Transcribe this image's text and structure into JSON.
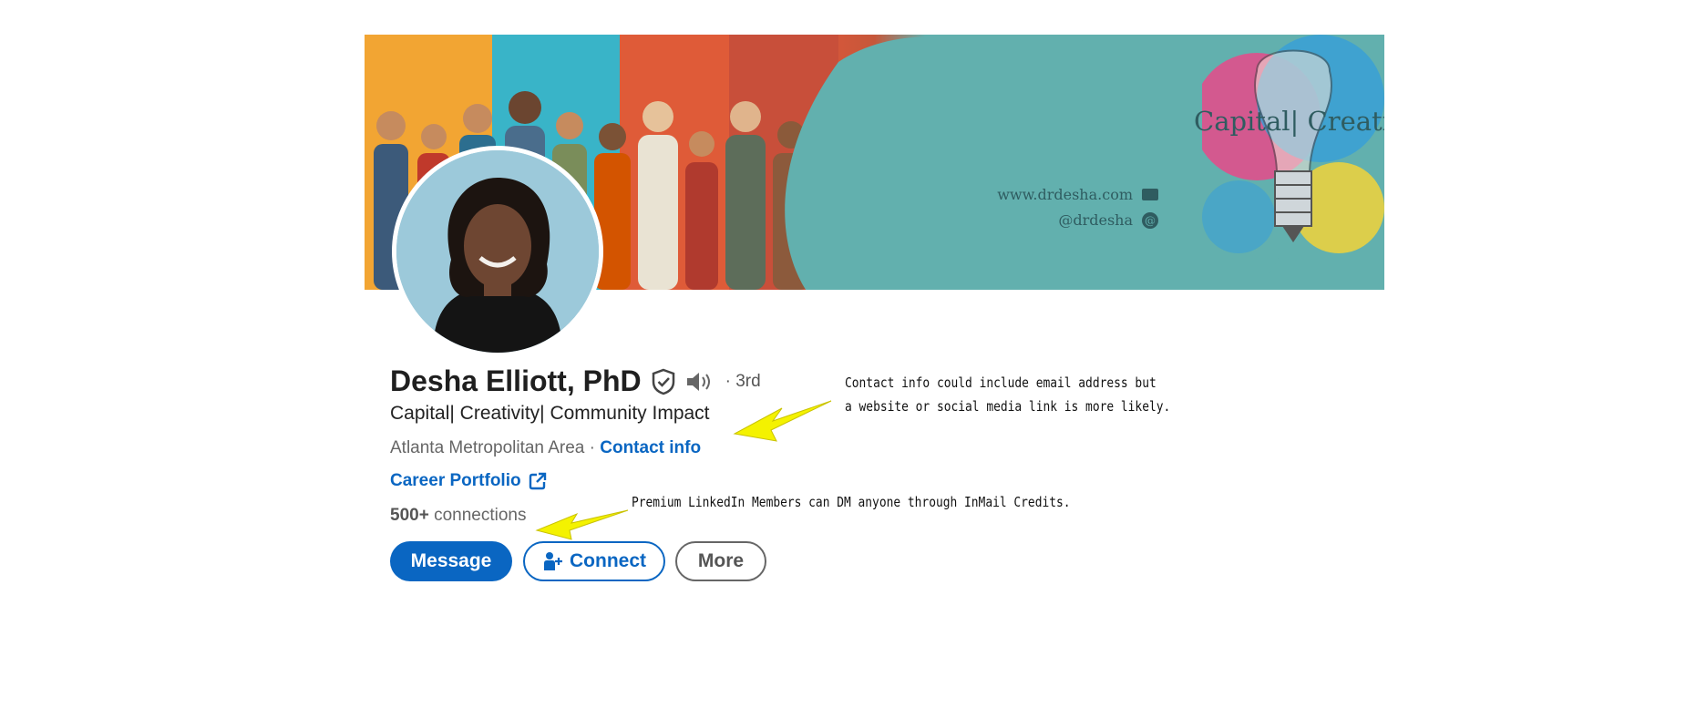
{
  "banner": {
    "tagline": "Capital| Creativity| Community",
    "website": "www.drdesha.com",
    "handle": "@drdesha",
    "icons": [
      "mail-icon",
      "at-icon"
    ]
  },
  "profile": {
    "name": "Desha Elliott, PhD",
    "degree": "· 3rd",
    "headline": "Capital| Creativity| Community Impact",
    "location": "Atlanta Metropolitan Area",
    "location_sep": " · ",
    "contact_info": "Contact info",
    "portfolio_label": "Career Portfolio",
    "connections_count": "500+",
    "connections_label": " connections"
  },
  "actions": {
    "message": "Message",
    "connect": "Connect",
    "more": "More"
  },
  "annotations": {
    "contact_line1": "Contact info could include email address but",
    "contact_line2": "a website or social media link is more likely.",
    "premium": "Premium LinkedIn Members can DM anyone through InMail Credits."
  },
  "colors": {
    "linkedin_blue": "#0a66c2",
    "banner_teal": "#62b0ae",
    "annotation_arrow": "#f4f200"
  }
}
